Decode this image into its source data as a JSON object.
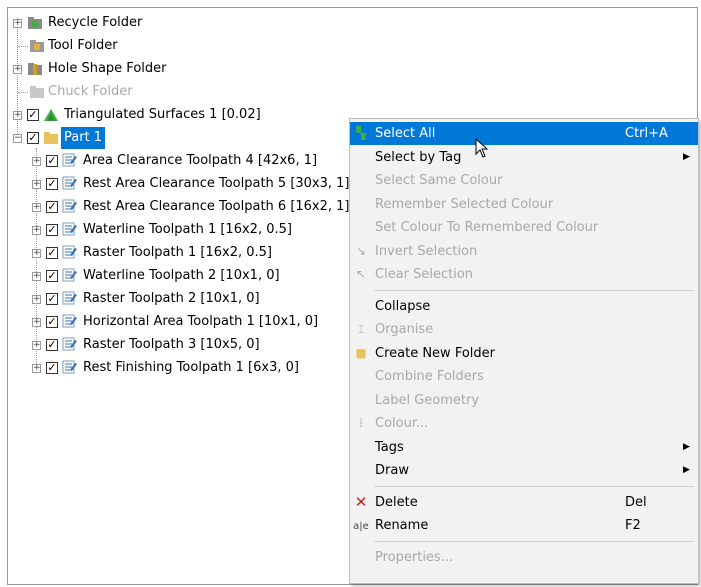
{
  "tree": {
    "top_items": [
      {
        "label": "Recycle Folder",
        "icon": "recycle-folder-icon",
        "expandable": true
      },
      {
        "label": "Tool Folder",
        "icon": "tool-folder-icon",
        "expandable": false
      },
      {
        "label": "Hole Shape Folder",
        "icon": "hole-shape-folder-icon",
        "expandable": true
      },
      {
        "label": "Chuck Folder",
        "icon": "chuck-folder-icon",
        "expandable": false,
        "disabled": true
      },
      {
        "label": "Triangulated Surfaces 1 [0.02]",
        "icon": "surface-icon",
        "expandable": true,
        "checked": true
      },
      {
        "label": "Part 1",
        "icon": "folder-icon",
        "expandable": true,
        "checked": true,
        "selected": true
      }
    ],
    "children": [
      "Area Clearance Toolpath 4 [42x6, 1]",
      "Rest Area Clearance Toolpath 5 [30x3, 1]",
      "Rest Area Clearance Toolpath 6 [16x2, 1]",
      "Waterline Toolpath 1 [16x2, 0.5]",
      "Raster Toolpath 1 [16x2, 0.5]",
      "Waterline Toolpath 2 [10x1, 0]",
      "Raster Toolpath 2 [10x1, 0]",
      "Horizontal Area Toolpath 1 [10x1, 0]",
      "Raster Toolpath 3 [10x5, 0]",
      "Rest Finishing Toolpath 1 [6x3, 0]"
    ]
  },
  "menu": {
    "items": [
      {
        "label": "Select All",
        "shortcut": "Ctrl+A",
        "highlighted": true,
        "icon": "select-all-icon"
      },
      {
        "label": "Select by Tag",
        "submenu": true
      },
      {
        "label": "Select Same Colour",
        "disabled": true
      },
      {
        "label": "Remember Selected Colour",
        "disabled": true
      },
      {
        "label": "Set Colour To Remembered Colour",
        "disabled": true
      },
      {
        "label": "Invert Selection",
        "disabled": true,
        "icon": "invert-selection-icon"
      },
      {
        "label": "Clear Selection",
        "disabled": true,
        "icon": "clear-selection-icon"
      },
      {
        "separator": true
      },
      {
        "label": "Collapse"
      },
      {
        "label": "Organise",
        "disabled": true,
        "icon": "organise-icon"
      },
      {
        "label": "Create New Folder",
        "icon": "new-folder-icon"
      },
      {
        "label": "Combine Folders",
        "disabled": true
      },
      {
        "label": "Label Geometry",
        "disabled": true
      },
      {
        "label": "Colour...",
        "disabled": true,
        "icon": "colour-icon"
      },
      {
        "label": "Tags",
        "submenu": true
      },
      {
        "label": "Draw",
        "submenu": true
      },
      {
        "separator": true
      },
      {
        "label": "Delete",
        "shortcut": "Del",
        "icon": "delete-icon"
      },
      {
        "label": "Rename",
        "shortcut": "F2",
        "icon": "rename-icon"
      },
      {
        "separator": true
      },
      {
        "label": "Properties...",
        "disabled": true
      }
    ]
  },
  "colors": {
    "accent": "#0078d7",
    "disabled_text": "#a8a8a8",
    "menu_bg": "#f2f2f2"
  }
}
